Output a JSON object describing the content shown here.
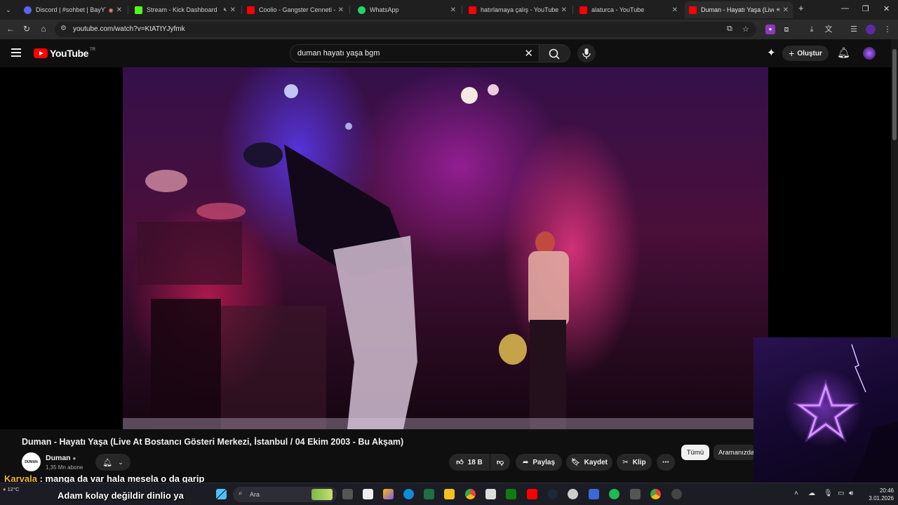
{
  "browser": {
    "tabs": [
      {
        "label": "Discord | #sohbet | BayYT",
        "favicon_color": "#5865f2"
      },
      {
        "label": "Stream - Kick Dashboard",
        "favicon_color": "#53fc18"
      },
      {
        "label": "Coolio - Gangster Cenneti - Yo",
        "favicon_color": "#ff0000"
      },
      {
        "label": "WhatsApp",
        "favicon_color": "#25d366"
      },
      {
        "label": "hatırlamaya çalış - YouTube",
        "favicon_color": "#ff0000"
      },
      {
        "label": "alaturca - YouTube",
        "favicon_color": "#ff0000"
      },
      {
        "label": "Duman - Hayatı Yaşa (Live",
        "favicon_color": "#ff0000"
      }
    ],
    "new_tab_icon": "plus-icon",
    "url": "youtube.com/watch?v=KtATtYJyfmk"
  },
  "youtube": {
    "logo_text": "YouTube",
    "country_code": "TR",
    "search_query": "duman hayatı yaşa bgm",
    "create_label": "Oluştur",
    "brand_color": "#ff0000"
  },
  "video": {
    "title": "Duman - Hayatı Yaşa (Live At Bostancı Gösteri Merkezi, İstanbul / 04 Ekim 2003 - Bu Akşam)",
    "channel": {
      "name": "Duman",
      "avatar_text": "DUMAN",
      "subscribers": "1,35 Mn abone",
      "verified_icon": "verified-icon"
    },
    "actions": {
      "likes": "18 B",
      "share": "Paylaş",
      "save": "Kaydet",
      "clip": "Klip"
    }
  },
  "sidebar_chips": {
    "all": "Tümü",
    "search": "Aramanızda"
  },
  "chat": [
    {
      "user": "Karvala",
      "message": ": manga da var hala mesela o da garip"
    },
    {
      "user": "",
      "message": "Adam kolay değildir dinlio ya"
    }
  ],
  "taskbar": {
    "weather": "12°C",
    "search_placeholder": "Ara",
    "time": "20:46",
    "date": "3.01.2026"
  }
}
